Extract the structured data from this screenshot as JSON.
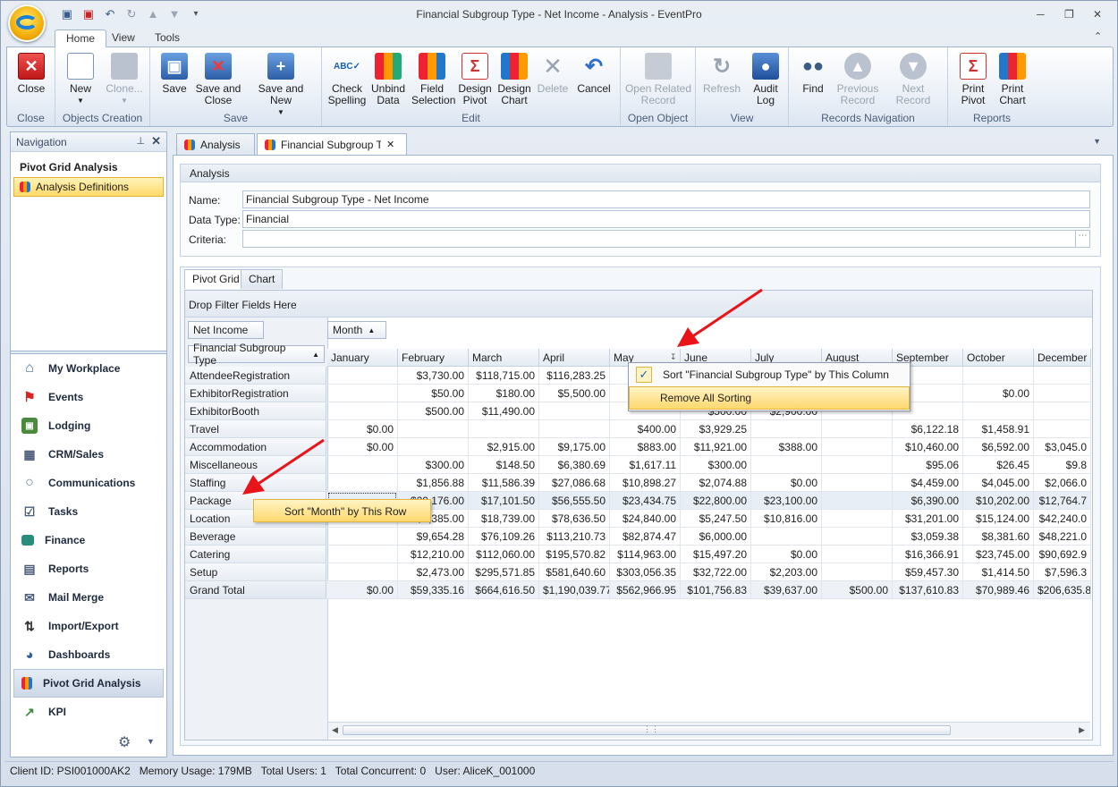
{
  "window": {
    "title": "Financial Subgroup Type - Net Income - Analysis - EventPro"
  },
  "ribbon_tabs": [
    "Home",
    "View",
    "Tools"
  ],
  "ribbon": {
    "groups": [
      {
        "label": "Close",
        "buttons": [
          "Close"
        ]
      },
      {
        "label": "Objects Creation",
        "buttons": [
          "New",
          "Clone..."
        ]
      },
      {
        "label": "Save",
        "buttons": [
          "Save",
          "Save and Close",
          "Save and New"
        ]
      },
      {
        "label": "Edit",
        "buttons": [
          "Check Spelling",
          "Unbind Data",
          "Field Selection",
          "Design Pivot",
          "Design Chart",
          "Delete",
          "Cancel"
        ]
      },
      {
        "label": "Open Object",
        "buttons": [
          "Open Related Record"
        ]
      },
      {
        "label": "View",
        "buttons": [
          "Refresh",
          "Audit Log"
        ]
      },
      {
        "label": "Records Navigation",
        "buttons": [
          "Find",
          "Previous Record",
          "Next Record"
        ]
      },
      {
        "label": "Reports",
        "buttons": [
          "Print Pivot",
          "Print Chart"
        ]
      }
    ]
  },
  "nav": {
    "header": "Navigation",
    "section": "Pivot Grid Analysis",
    "selected": "Analysis Definitions",
    "items": [
      "My Workplace",
      "Events",
      "Lodging",
      "CRM/Sales",
      "Communications",
      "Tasks",
      "Finance",
      "Reports",
      "Mail Merge",
      "Import/Export",
      "Dashboards",
      "Pivot Grid Analysis",
      "KPI"
    ]
  },
  "doc_tabs": [
    "Analysis",
    "Financial Subgroup Type"
  ],
  "analysis": {
    "header": "Analysis",
    "name_label": "Name:",
    "name_value": "Financial Subgroup Type - Net Income",
    "datatype_label": "Data Type:",
    "datatype_value": "Financial",
    "criteria_label": "Criteria:",
    "criteria_value": ""
  },
  "pivot_tabs": [
    "Pivot Grid",
    "Chart"
  ],
  "pivot": {
    "filter_area": "Drop Filter Fields Here",
    "data_field": "Net Income",
    "column_field": "Month",
    "row_field": "Financial Subgroup Type",
    "columns": [
      "January",
      "February",
      "March",
      "April",
      "May",
      "June",
      "July",
      "August",
      "September",
      "October",
      "December"
    ],
    "rows": [
      {
        "label": "AttendeeRegistration",
        "values": [
          "",
          "$3,730.00",
          "$118,715.00",
          "$116,283.25",
          "",
          "",
          "",
          "",
          "",
          "",
          ""
        ]
      },
      {
        "label": "ExhibitorRegistration",
        "values": [
          "",
          "$50.00",
          "$180.00",
          "$5,500.00",
          "",
          "",
          "",
          "",
          "",
          "$0.00",
          ""
        ]
      },
      {
        "label": "ExhibitorBooth",
        "values": [
          "",
          "$500.00",
          "$11,490.00",
          "",
          "",
          "$500.00",
          "$2,900.00",
          "",
          "",
          "",
          ""
        ]
      },
      {
        "label": "Travel",
        "values": [
          "$0.00",
          "",
          "",
          "",
          "$400.00",
          "$3,929.25",
          "",
          "",
          "$6,122.18",
          "$1,458.91",
          ""
        ]
      },
      {
        "label": "Accommodation",
        "values": [
          "$0.00",
          "",
          "$2,915.00",
          "$9,175.00",
          "$883.00",
          "$11,921.00",
          "$388.00",
          "",
          "$10,460.00",
          "$6,592.00",
          "$3,045.0"
        ]
      },
      {
        "label": "Miscellaneous",
        "values": [
          "",
          "$300.00",
          "$148.50",
          "$6,380.69",
          "$1,617.11",
          "$300.00",
          "",
          "",
          "$95.06",
          "$26.45",
          "$9.8"
        ]
      },
      {
        "label": "Staffing",
        "values": [
          "",
          "$1,856.88",
          "$11,586.39",
          "$27,086.68",
          "$10,898.27",
          "$2,074.88",
          "$0.00",
          "",
          "$4,459.00",
          "$4,045.00",
          "$2,066.0"
        ]
      },
      {
        "label": "Package",
        "values": [
          "",
          "$20,176.00",
          "$17,101.50",
          "$56,555.50",
          "$23,434.75",
          "$22,800.00",
          "$23,100.00",
          "",
          "$6,390.00",
          "$10,202.00",
          "$12,764.7"
        ]
      },
      {
        "label": "Location",
        "values": [
          "",
          "$4,385.00",
          "$18,739.00",
          "$78,636.50",
          "$24,840.00",
          "$5,247.50",
          "$10,816.00",
          "",
          "$31,201.00",
          "$15,124.00",
          "$42,240.0"
        ]
      },
      {
        "label": "Beverage",
        "values": [
          "",
          "$9,654.28",
          "$76,109.26",
          "$113,210.73",
          "$82,874.47",
          "$6,000.00",
          "",
          "",
          "$3,059.38",
          "$8,381.60",
          "$48,221.0"
        ]
      },
      {
        "label": "Catering",
        "values": [
          "",
          "$12,210.00",
          "$112,060.00",
          "$195,570.82",
          "$114,963.00",
          "$15,497.20",
          "$0.00",
          "",
          "$16,366.91",
          "$23,745.00",
          "$90,692.9"
        ]
      },
      {
        "label": "Setup",
        "values": [
          "",
          "$2,473.00",
          "$295,571.85",
          "$581,640.60",
          "$303,056.35",
          "$32,722.00",
          "$2,203.00",
          "",
          "$59,457.30",
          "$1,414.50",
          "$7,596.3"
        ]
      },
      {
        "label": "Grand Total",
        "values": [
          "$0.00",
          "$59,335.16",
          "$664,616.50",
          "$1,190,039.77",
          "$562,966.95",
          "$101,756.83",
          "$39,637.00",
          "$500.00",
          "$137,610.83",
          "$70,989.46",
          "$206,635.8"
        ]
      }
    ]
  },
  "context_menu_col": {
    "items": [
      "Sort \"Financial Subgroup Type\" by This Column",
      "Remove All Sorting"
    ]
  },
  "context_menu_row": {
    "items": [
      "Sort \"Month\" by This Row"
    ]
  },
  "status": {
    "client_id": "Client ID: PSI001000AK2",
    "memory": "Memory Usage: 179MB",
    "users": "Total Users: 1",
    "concurrent": "Total Concurrent: 0",
    "user": "User: AliceK_001000"
  },
  "colors": {
    "accent": "#ffd86e",
    "arrow": "#e8141a",
    "frame": "#9fb4d1"
  }
}
